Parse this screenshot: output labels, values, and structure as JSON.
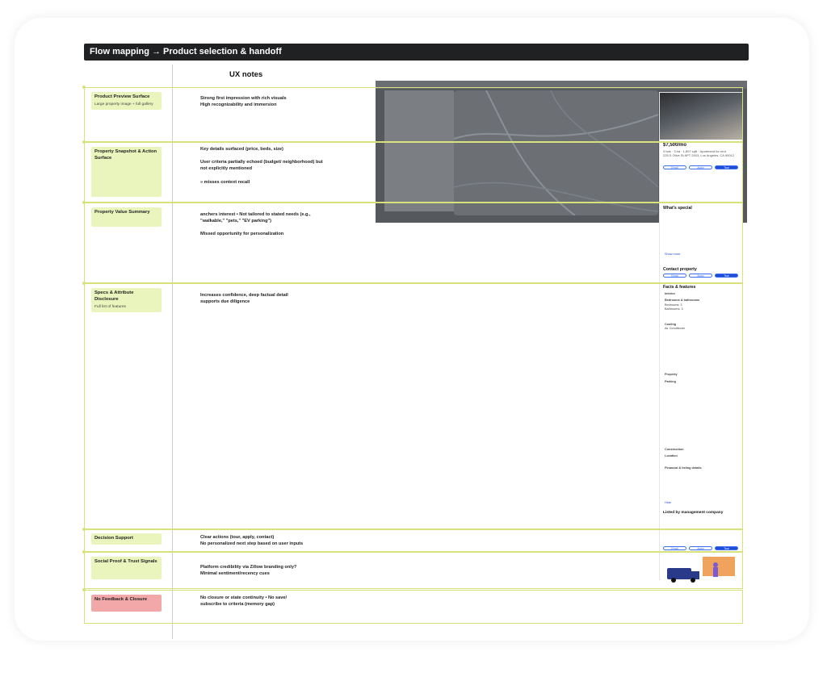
{
  "header": {
    "title": "Flow mapping →  Product selection & handoff"
  },
  "column": {
    "ux_notes": "UX notes"
  },
  "rows": [
    {
      "title": "Product Preview Surface",
      "subtitle": "Large property image + full gallery",
      "note": "Strong first impression with rich visuals\nHigh recognizability and immersion"
    },
    {
      "title": "Property Snapshot & Action Surface",
      "subtitle": "",
      "note": "Key details surfaced (price, beds, size)\n\nUser criteria partially echoed (budget/ neighborhood) but not explicitly mentioned\n\n» misses context recall"
    },
    {
      "title": "Property Value Summary",
      "subtitle": "",
      "note": "anchers interest  • Not tailored to stated needs (e.g., \"walkable,\" \"pets,\" \"EV parking\")\n\nMissed opportunity for personalization"
    },
    {
      "title": "Specs & Attribute Disclosure",
      "subtitle": "Full list of features",
      "note": "Increases confidence, deep factual detail supports due diligence"
    },
    {
      "title": "Decision Support",
      "subtitle": "",
      "note": "Clear actions (tour, apply, contact)\nNo personalized next step based on user inputs"
    },
    {
      "title": "Social Proof & Trust Signals",
      "subtitle": "",
      "note": "Platform credibility via Zillow branding only?\nMinimal sentiment/recency cues"
    },
    {
      "title": "No Feedback & Closure",
      "subtitle": "",
      "note": "No closure or state continuity  • No save/ subscribe to criteria (memory gap)"
    }
  ],
  "listing": {
    "price": "$7,500/mo",
    "summary": "3 bds · 3 ba · 1,897 sqft · Apartment for rent",
    "address": "225 S Olive St APT 2503, Los Angeles, CA 90012",
    "buttons": [
      "Email",
      "Apply",
      "Tour"
    ],
    "whats_special": "What's special",
    "show_more": "Show more",
    "contact": "Contact property",
    "facts": "Facts & features",
    "interior": "Interior",
    "beds_baths": "Bedrooms & bathrooms",
    "beds": "Bedrooms: 3",
    "baths": "Bathrooms: 3",
    "cooling": "Cooling",
    "ac": "Air Conditioner",
    "property": "Property",
    "parking": "Parking",
    "construction": "Construction",
    "location": "Location",
    "financial": "Financial & listing details",
    "hide": "Hide",
    "listed_by": "Listed by management company"
  },
  "colors": {
    "header_bg": "#1f2123",
    "sticky": "#eaf5bd",
    "sticky_alert": "#f2a8a8",
    "row_border": "#d9e27a",
    "accent": "#1f4ed8"
  }
}
